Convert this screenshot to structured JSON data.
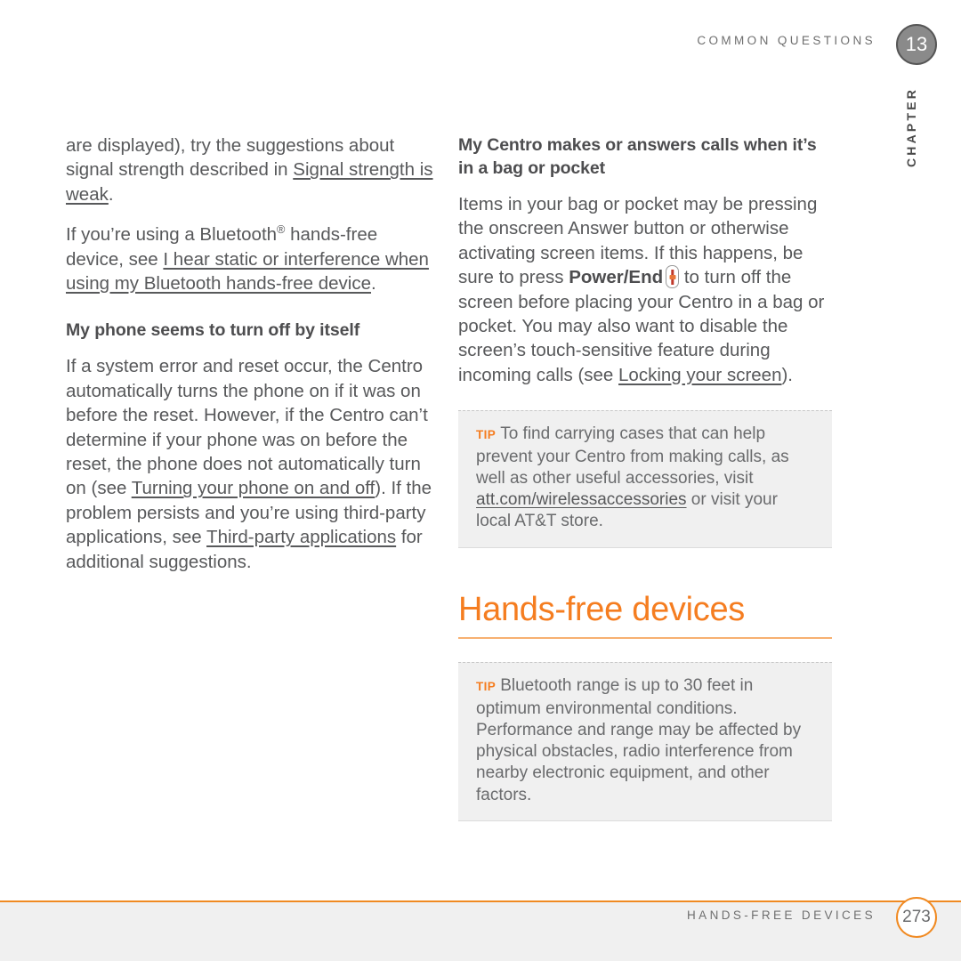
{
  "header": {
    "running_head": "COMMON QUESTIONS",
    "chapter_number": "13",
    "chapter_word": "CHAPTER"
  },
  "left_column": {
    "paragraph_1_part_1": "are displayed), try the suggestions about signal strength described in ",
    "paragraph_1_link": "Signal strength is weak",
    "paragraph_1_part_2": ".",
    "paragraph_2_part_1": "If you’re using a Bluetooth",
    "paragraph_2_superscript": "®",
    "paragraph_2_part_2": " hands-free device, see ",
    "paragraph_2_link": "I hear static or interference when using my Bluetooth hands-free device",
    "paragraph_2_part_3": ".",
    "heading_1": "My phone seems to turn off by itself",
    "paragraph_3_part_1": "If a system error and reset occur, the Centro automatically turns the phone on if it was on before the reset. However, if the Centro can’t determine if your phone was on before the reset, the phone does not automatically turn on (see ",
    "paragraph_3_link_1": "Turning your phone on and off",
    "paragraph_3_part_2": "). If the problem persists and you’re using third-party applications, see ",
    "paragraph_3_link_2": "Third-party applications",
    "paragraph_3_part_3": " for additional suggestions."
  },
  "right_column": {
    "heading_1": "My Centro makes or answers calls when it’s in a bag or pocket",
    "paragraph_1_part_1": "Items in your bag or pocket may be pressing the onscreen Answer button or otherwise activating screen items. If this happens, be sure to press ",
    "paragraph_1_bold": "Power/End",
    "paragraph_1_part_2": " to turn off the screen before placing your Centro in a bag or pocket. You may also want to disable the screen’s touch-sensitive feature during incoming calls (see ",
    "paragraph_1_link": "Locking your screen",
    "paragraph_1_part_3": ").",
    "tip_1": {
      "label": "TIP",
      "text_part_1": "To find carrying cases that can help prevent your Centro from making calls, as well as other useful accessories, visit ",
      "link": "att.com/wirelessaccessories",
      "text_part_2": " or visit your local AT&T store."
    },
    "section_heading": "Hands-free devices",
    "tip_2": {
      "label": "TIP",
      "text": "Bluetooth range is up to 30 feet in optimum environmental conditions. Performance and range may be affected by physical obstacles, radio interference from nearby electronic equipment, and other factors."
    }
  },
  "footer": {
    "running_foot": "HANDS-FREE DEVICES",
    "page_number": "273"
  },
  "colors": {
    "accent_orange": "#f57d20",
    "rule_orange": "#f08a22",
    "body_gray": "#58595b",
    "tip_background": "#f0f0f0",
    "chapter_badge_gray": "#8a8a8a"
  }
}
